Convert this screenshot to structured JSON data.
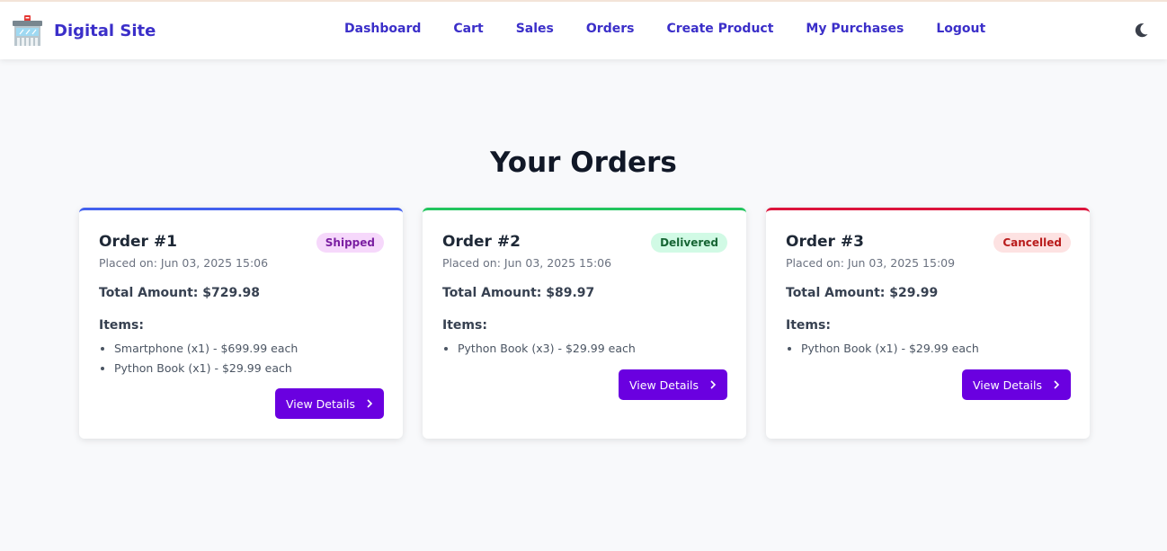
{
  "nav": {
    "brand": "Digital Site",
    "links": [
      {
        "label": "Dashboard"
      },
      {
        "label": "Cart"
      },
      {
        "label": "Sales"
      },
      {
        "label": "Orders"
      },
      {
        "label": "Create Product"
      },
      {
        "label": "My Purchases"
      },
      {
        "label": "Logout"
      }
    ],
    "theme_toggle_icon": "moon-icon"
  },
  "page": {
    "title": "Your Orders"
  },
  "orders": [
    {
      "title": "Order #1",
      "status": "Shipped",
      "status_colors": {
        "bg": "#f6d8fb",
        "text": "#7b1fa2"
      },
      "placed": "Placed on: Jun 03, 2025 15:06",
      "total": "Total Amount: $729.98",
      "items_heading": "Items:",
      "items": [
        "Smartphone (x1) - $699.99 each",
        "Python Book (x1) - $29.99 each"
      ],
      "button": "View Details",
      "accent": "#4361ee"
    },
    {
      "title": "Order #2",
      "status": "Delivered",
      "status_colors": {
        "bg": "#d1fae5",
        "text": "#166534"
      },
      "placed": "Placed on: Jun 03, 2025 15:06",
      "total": "Total Amount: $89.97",
      "items_heading": "Items:",
      "items": [
        "Python Book (x3) - $29.99 each"
      ],
      "button": "View Details",
      "accent": "#22c55e"
    },
    {
      "title": "Order #3",
      "status": "Cancelled",
      "status_colors": {
        "bg": "#fde2e2",
        "text": "#b91c1c"
      },
      "placed": "Placed on: Jun 03, 2025 15:09",
      "total": "Total Amount: $29.99",
      "items_heading": "Items:",
      "items": [
        "Python Book (x1) - $29.99 each"
      ],
      "button": "View Details",
      "accent": "#dc143c"
    }
  ],
  "colors": {
    "brand": "#3b2fc9",
    "button": "#6a00e0",
    "page_bg": "#f8f9fb"
  }
}
